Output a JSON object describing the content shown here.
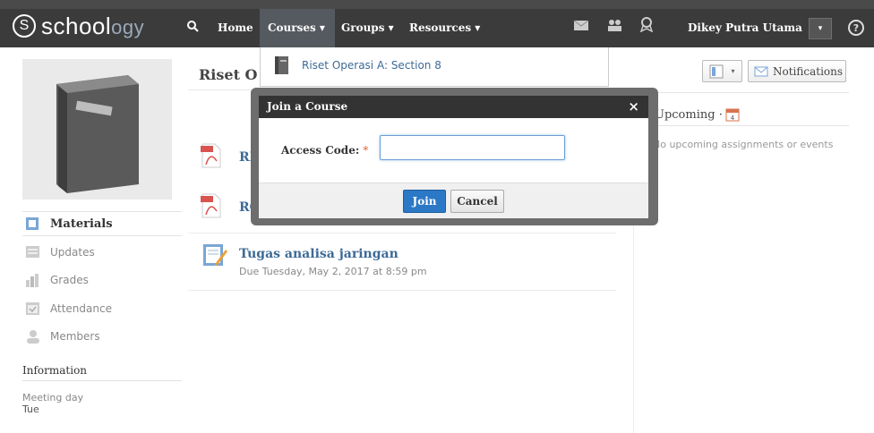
{
  "app": {
    "logo_letter": "S",
    "logo_text_a": "school",
    "logo_text_b": "ogy"
  },
  "nav": {
    "home": "Home",
    "courses": "Courses ▾",
    "groups": "Groups ▾",
    "resources": "Resources ▾",
    "user_name": "Dikey Putra Utama",
    "user_caret": "▾",
    "help": "?"
  },
  "courses_dropdown": {
    "items": [
      {
        "label": "Riset Operasi A: Section 8"
      }
    ]
  },
  "sidebar": {
    "items": [
      {
        "label": "Materials",
        "icon": "materials-icon",
        "active": true
      },
      {
        "label": "Updates",
        "icon": "updates-icon"
      },
      {
        "label": "Grades",
        "icon": "grades-icon"
      },
      {
        "label": "Attendance",
        "icon": "attendance-icon"
      },
      {
        "label": "Members",
        "icon": "members-icon"
      }
    ],
    "info_header": "Information",
    "meeting_label": "Meeting day",
    "meeting_value": "Tue"
  },
  "main": {
    "course_title": "Riset O",
    "materials": [
      {
        "title": "RP",
        "type": "pdf"
      },
      {
        "title": "RO",
        "type": "pdf"
      },
      {
        "title": "Tugas analisa jaringan",
        "sub": "Due Tuesday, May 2, 2017 at 8:59 pm",
        "type": "assignment"
      }
    ]
  },
  "right": {
    "view_caret": "▾",
    "notifications": "Notifications",
    "upcoming_title": "Upcoming ·",
    "calendar_day": "4",
    "upcoming_empty": "No upcoming assignments or events"
  },
  "modal": {
    "title": "Join a Course",
    "close": "×",
    "access_label": "Access Code:",
    "required_mark": "*",
    "access_value": "",
    "join": "Join",
    "cancel": "Cancel"
  }
}
